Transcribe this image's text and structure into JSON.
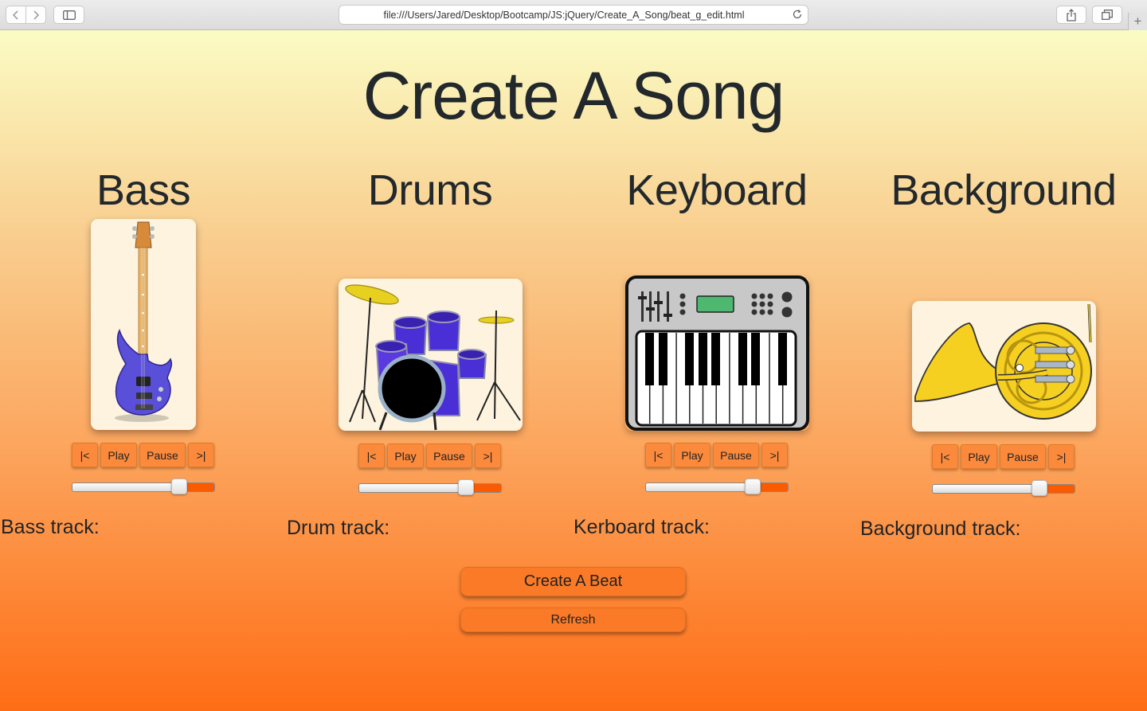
{
  "browser": {
    "url": "file:///Users/Jared/Desktop/Bootcamp/JS:jQuery/Create_A_Song/beat_g_edit.html",
    "icons": {
      "back": "chevron-left-icon",
      "forward": "chevron-right-icon",
      "sidebar": "sidebar-icon",
      "reload": "reload-icon",
      "share": "share-icon",
      "tabs": "tabs-icon",
      "new_tab": "plus-icon"
    }
  },
  "page": {
    "title": "Create A Song",
    "colors": {
      "gradient_top": "#fafcc4",
      "gradient_bottom": "#fe6d15",
      "button": "#fb8a3d",
      "slider_fill": "#fb5b00",
      "text": "#22282b"
    }
  },
  "instruments": [
    {
      "title": "Bass",
      "image_icon": "bass-guitar-icon",
      "controls": [
        "|<",
        "Play",
        "Pause",
        ">|"
      ],
      "volume": 0.75,
      "track_label": "Bass track:"
    },
    {
      "title": "Drums",
      "image_icon": "drum-kit-icon",
      "controls": [
        "|<",
        "Play",
        "Pause",
        ">|"
      ],
      "volume": 0.75,
      "track_label": "Drum track:"
    },
    {
      "title": "Keyboard",
      "image_icon": "keyboard-synth-icon",
      "controls": [
        "|<",
        "Play",
        "Pause",
        ">|"
      ],
      "volume": 0.75,
      "track_label": "Kerboard track:"
    },
    {
      "title": "Background",
      "image_icon": "french-horn-icon",
      "controls": [
        "|<",
        "Play",
        "Pause",
        ">|"
      ],
      "volume": 0.75,
      "track_label": "Background track:"
    }
  ],
  "actions": {
    "create_beat": "Create A Beat",
    "refresh": "Refresh"
  }
}
